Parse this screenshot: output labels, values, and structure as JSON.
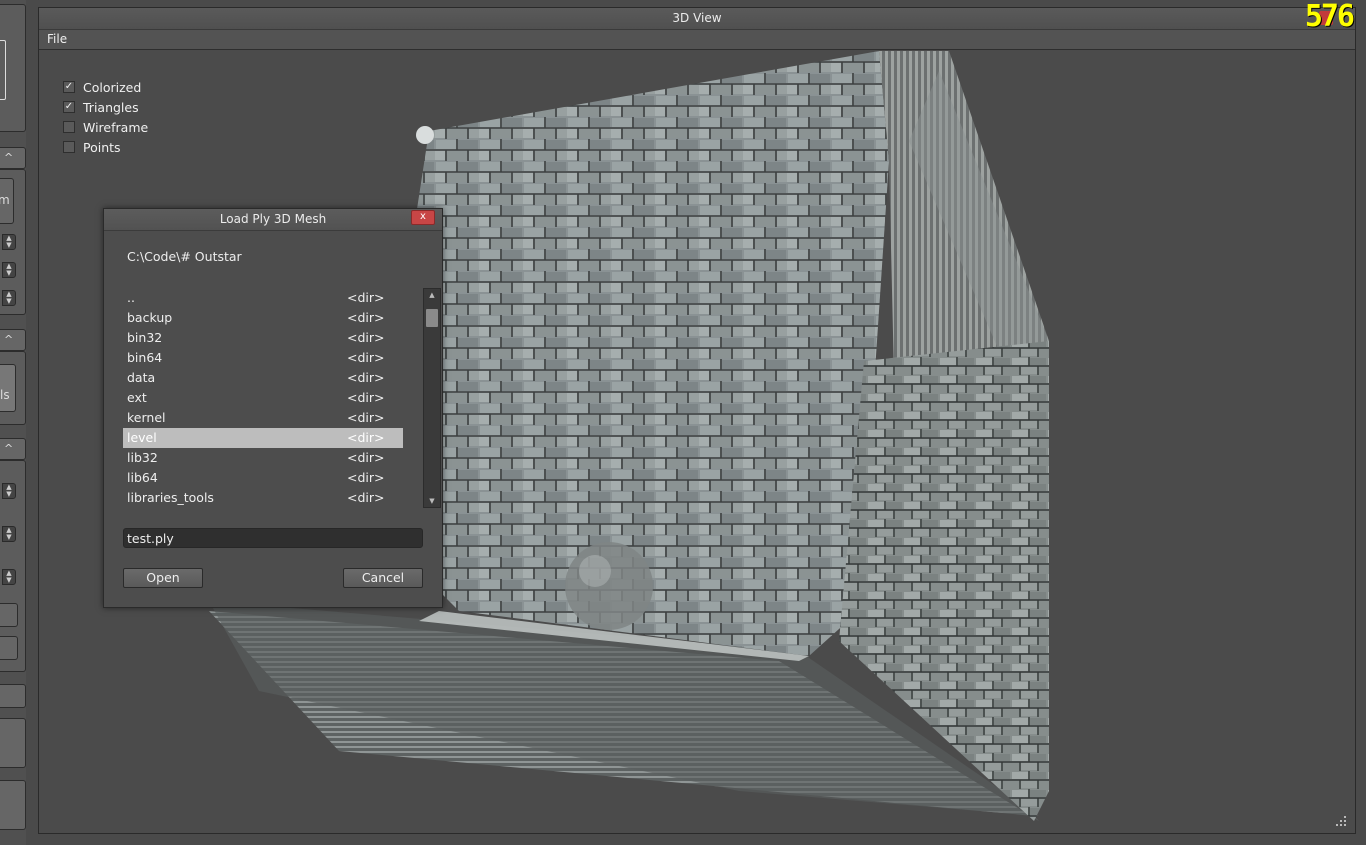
{
  "window": {
    "title": "3D View",
    "fps": "576"
  },
  "menu": {
    "file_label": "File"
  },
  "left_panel": {
    "partial_text_1": "m",
    "partial_text_2": "ls"
  },
  "toggles": [
    {
      "label": "Colorized",
      "checked": true
    },
    {
      "label": "Triangles",
      "checked": true
    },
    {
      "label": "Wireframe",
      "checked": false
    },
    {
      "label": "Points",
      "checked": false
    }
  ],
  "dialog": {
    "title": "Load Ply 3D Mesh",
    "close_label": "x",
    "path": "C:\\Code\\# Outstar",
    "files": [
      {
        "name": "..",
        "type": "<dir>"
      },
      {
        "name": "backup",
        "type": "<dir>"
      },
      {
        "name": "bin32",
        "type": "<dir>"
      },
      {
        "name": "bin64",
        "type": "<dir>"
      },
      {
        "name": "data",
        "type": "<dir>"
      },
      {
        "name": "ext",
        "type": "<dir>"
      },
      {
        "name": "kernel",
        "type": "<dir>"
      },
      {
        "name": "level",
        "type": "<dir>",
        "selected": true
      },
      {
        "name": "lib32",
        "type": "<dir>"
      },
      {
        "name": "lib64",
        "type": "<dir>"
      },
      {
        "name": "libraries_tools",
        "type": "<dir>"
      }
    ],
    "filename": "test.ply",
    "open_label": "Open",
    "cancel_label": "Cancel"
  },
  "colors": {
    "selection": "#bdbdbd",
    "close_red": "#c84646",
    "fps_yellow": "#ffff00"
  }
}
